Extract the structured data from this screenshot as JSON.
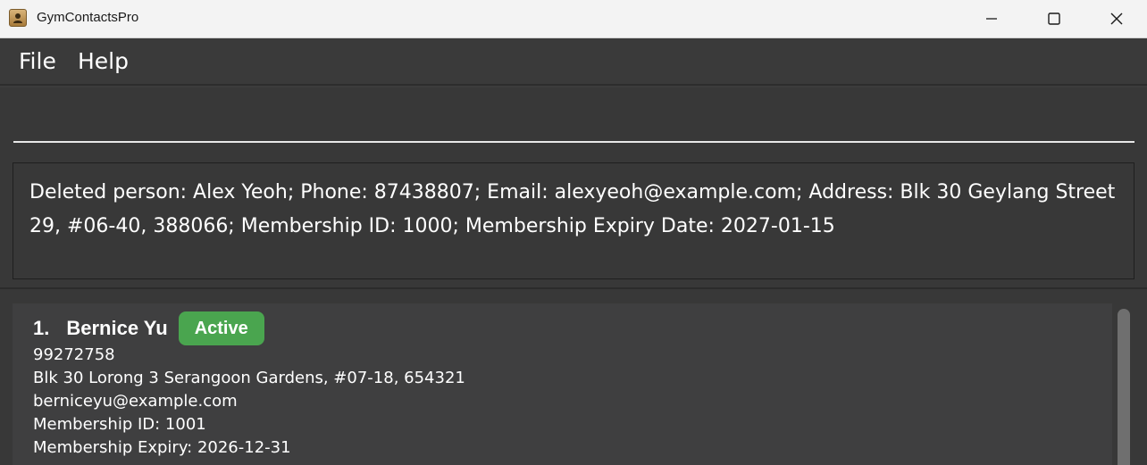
{
  "window": {
    "title": "GymContactsPro"
  },
  "menu": {
    "file_label": "File",
    "help_label": "Help"
  },
  "command_box": {
    "value": ""
  },
  "result_display": {
    "text": "Deleted person: Alex Yeoh; Phone: 87438807; Email: alexyeoh@example.com; Address: Blk 30 Geylang Street 29, #06-40, 388066; Membership ID: 1000; Membership Expiry Date: 2027-01-15"
  },
  "person_list": [
    {
      "index": "1.",
      "name": "Bernice Yu",
      "status": "Active",
      "phone": "99272758",
      "address": "Blk 30 Lorong 3 Serangoon Gardens, #07-18, 654321",
      "email": "berniceyu@example.com",
      "membership_id": "Membership ID: 1001",
      "membership_expiry": "Membership Expiry: 2026-12-31"
    }
  ],
  "colors": {
    "status_active": "#4aa54f",
    "background": "#383838",
    "card": "#3f3f40"
  }
}
